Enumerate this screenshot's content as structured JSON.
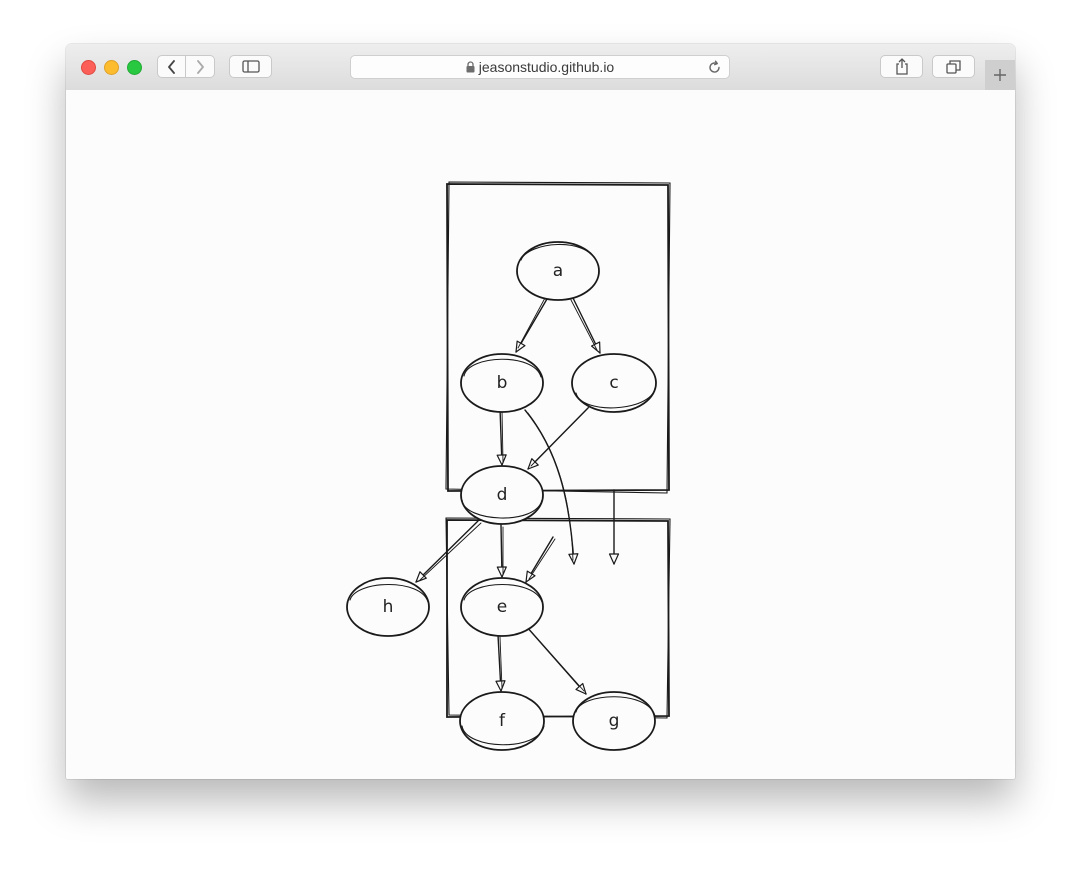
{
  "browser": {
    "url": "jeasonstudio.github.io"
  },
  "diagram": {
    "nodes": {
      "a": "a",
      "b": "b",
      "c": "c",
      "d": "d",
      "e": "e",
      "f": "f",
      "g": "g",
      "h": "h"
    },
    "edges": [
      [
        "a",
        "b"
      ],
      [
        "a",
        "c"
      ],
      [
        "b",
        "d"
      ],
      [
        "c",
        "d"
      ],
      [
        "b",
        "g"
      ],
      [
        "d",
        "h"
      ],
      [
        "d",
        "e"
      ],
      [
        "d",
        "cluster-2"
      ],
      [
        "e",
        "f"
      ],
      [
        "e",
        "g"
      ]
    ],
    "clusters": [
      [
        "a",
        "b",
        "c",
        "d"
      ],
      [
        "e",
        "f",
        "g"
      ]
    ]
  }
}
